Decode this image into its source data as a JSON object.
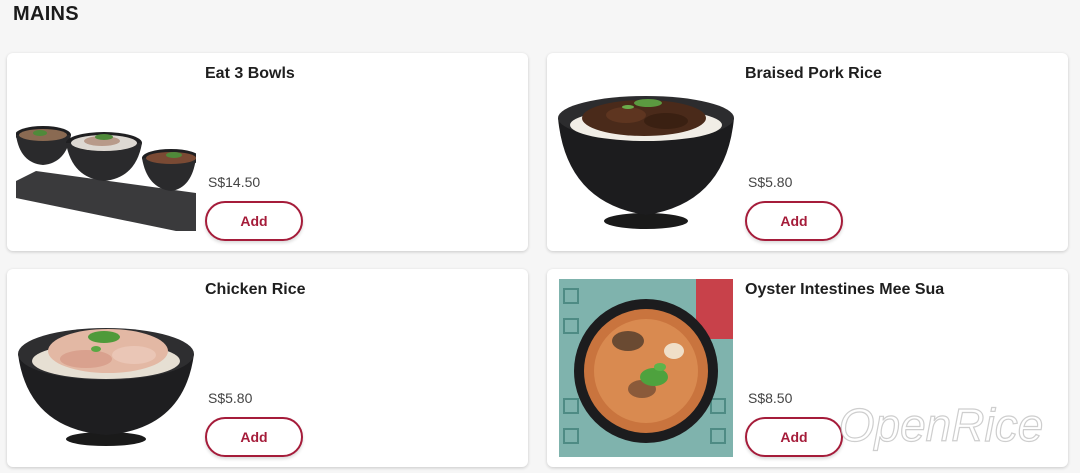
{
  "section": {
    "title": "MAINS"
  },
  "items": [
    {
      "name": "Eat 3 Bowls",
      "price": "S$14.50",
      "add_label": "Add"
    },
    {
      "name": "Braised Pork Rice",
      "price": "S$5.80",
      "add_label": "Add"
    },
    {
      "name": "Chicken Rice",
      "price": "S$5.80",
      "add_label": "Add"
    },
    {
      "name": "Oyster Intestines Mee Sua",
      "price": "S$8.50",
      "add_label": "Add"
    }
  ],
  "watermark": {
    "text": "OpenRice"
  },
  "colors": {
    "accent": "#a51c3a",
    "card_bg": "#ffffff",
    "page_bg": "#f6f6f6"
  },
  "icons": [
    "three-bowls-image",
    "braised-pork-bowl-image",
    "chicken-rice-bowl-image",
    "mee-sua-bowl-image"
  ]
}
